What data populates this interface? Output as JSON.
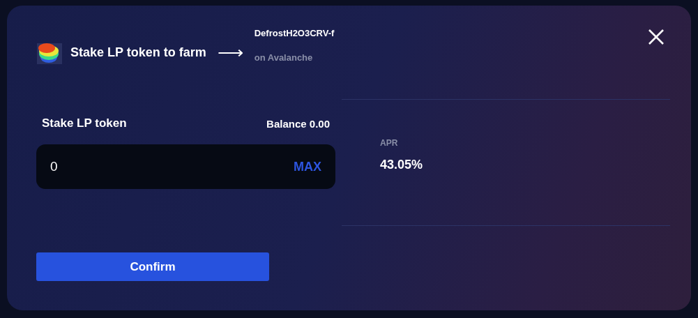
{
  "header": {
    "title": "Stake LP token to farm",
    "arrow": "⟶",
    "token": "DefrostH2O3CRV-f",
    "network": "on Avalanche"
  },
  "stake": {
    "label": "Stake LP token",
    "balance": "Balance 0.00",
    "value": "0",
    "max": "MAX"
  },
  "apr": {
    "label": "APR",
    "value": "43.05%"
  },
  "confirm": "Confirm"
}
